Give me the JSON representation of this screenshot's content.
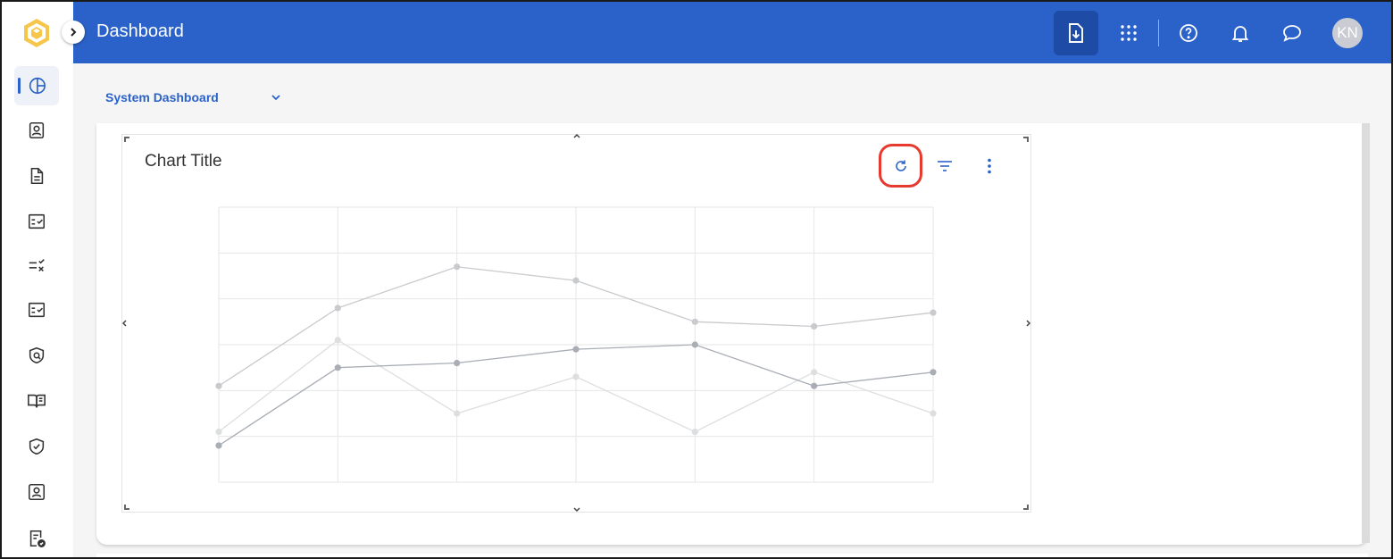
{
  "header": {
    "title": "Dashboard",
    "user_initials": "KN"
  },
  "sidebar": {
    "items": [
      {
        "icon": "pie-chart-icon",
        "active": true
      },
      {
        "icon": "contact-card-icon"
      },
      {
        "icon": "document-icon"
      },
      {
        "icon": "checklist-icon"
      },
      {
        "icon": "list-x-icon"
      },
      {
        "icon": "checklist-icon"
      },
      {
        "icon": "shield-search-icon"
      },
      {
        "icon": "book-icon"
      },
      {
        "icon": "shield-check-icon"
      },
      {
        "icon": "user-badge-icon"
      },
      {
        "icon": "document-check-icon"
      }
    ]
  },
  "dashboard_select": {
    "value": "System Dashboard"
  },
  "widget": {
    "title": "Chart Title"
  },
  "colors": {
    "brand": "#2b62c9",
    "highlight": "#e63a2e"
  },
  "chart_data": {
    "type": "line",
    "x": [
      0,
      1,
      2,
      3,
      4,
      5,
      6
    ],
    "ylim": [
      0,
      6
    ],
    "grid": true,
    "series": [
      {
        "values": [
          2.1,
          3.8,
          4.7,
          4.4,
          3.5,
          3.4,
          3.7
        ],
        "color": "#c8cacd"
      },
      {
        "values": [
          1.1,
          3.1,
          1.5,
          2.3,
          1.1,
          2.4,
          1.5
        ],
        "color": "#dcdee0"
      },
      {
        "values": [
          0.8,
          2.5,
          2.6,
          2.9,
          3.0,
          2.1,
          2.4
        ],
        "color": "#a9adb5"
      }
    ]
  }
}
